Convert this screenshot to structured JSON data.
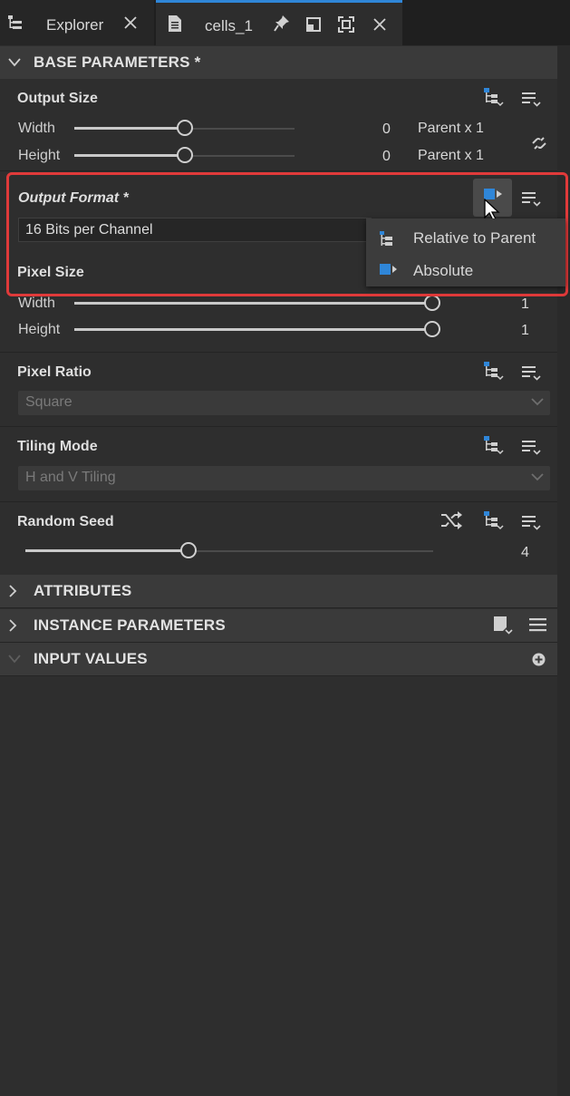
{
  "tabs": [
    {
      "label": "Explorer",
      "active": false
    },
    {
      "label": "cells_1",
      "active": true
    }
  ],
  "sections": {
    "base_parameters": {
      "title": "BASE PARAMETERS *",
      "expanded": true
    },
    "attributes": {
      "title": "ATTRIBUTES",
      "expanded": false
    },
    "instance_parameters": {
      "title": "INSTANCE PARAMETERS",
      "expanded": false
    },
    "input_values": {
      "title": "INPUT VALUES",
      "expanded": true
    }
  },
  "output_size": {
    "title": "Output Size",
    "width": {
      "label": "Width",
      "value": "0",
      "suffix": "Parent x 1",
      "level": 0.5
    },
    "height": {
      "label": "Height",
      "value": "0",
      "suffix": "Parent x 1",
      "level": 0.5
    }
  },
  "output_format": {
    "title": "Output Format *",
    "value": "16 Bits per Channel",
    "menu": [
      {
        "label": "Relative to Parent",
        "icon": "relative-to-parent-icon"
      },
      {
        "label": "Absolute",
        "icon": "absolute-icon"
      }
    ]
  },
  "pixel_size": {
    "title": "Pixel Size",
    "width": {
      "label": "Width",
      "value": "1",
      "level": 1.0
    },
    "height": {
      "label": "Height",
      "value": "1",
      "level": 1.0
    }
  },
  "pixel_ratio": {
    "title": "Pixel Ratio",
    "value": "Square"
  },
  "tiling_mode": {
    "title": "Tiling Mode",
    "value": "H and V Tiling"
  },
  "random_seed": {
    "title": "Random Seed",
    "value": "4",
    "level": 0.4
  },
  "colors": {
    "accent": "#2f86d8",
    "highlight": "#e03a3a",
    "background": "#2e2e2e"
  }
}
